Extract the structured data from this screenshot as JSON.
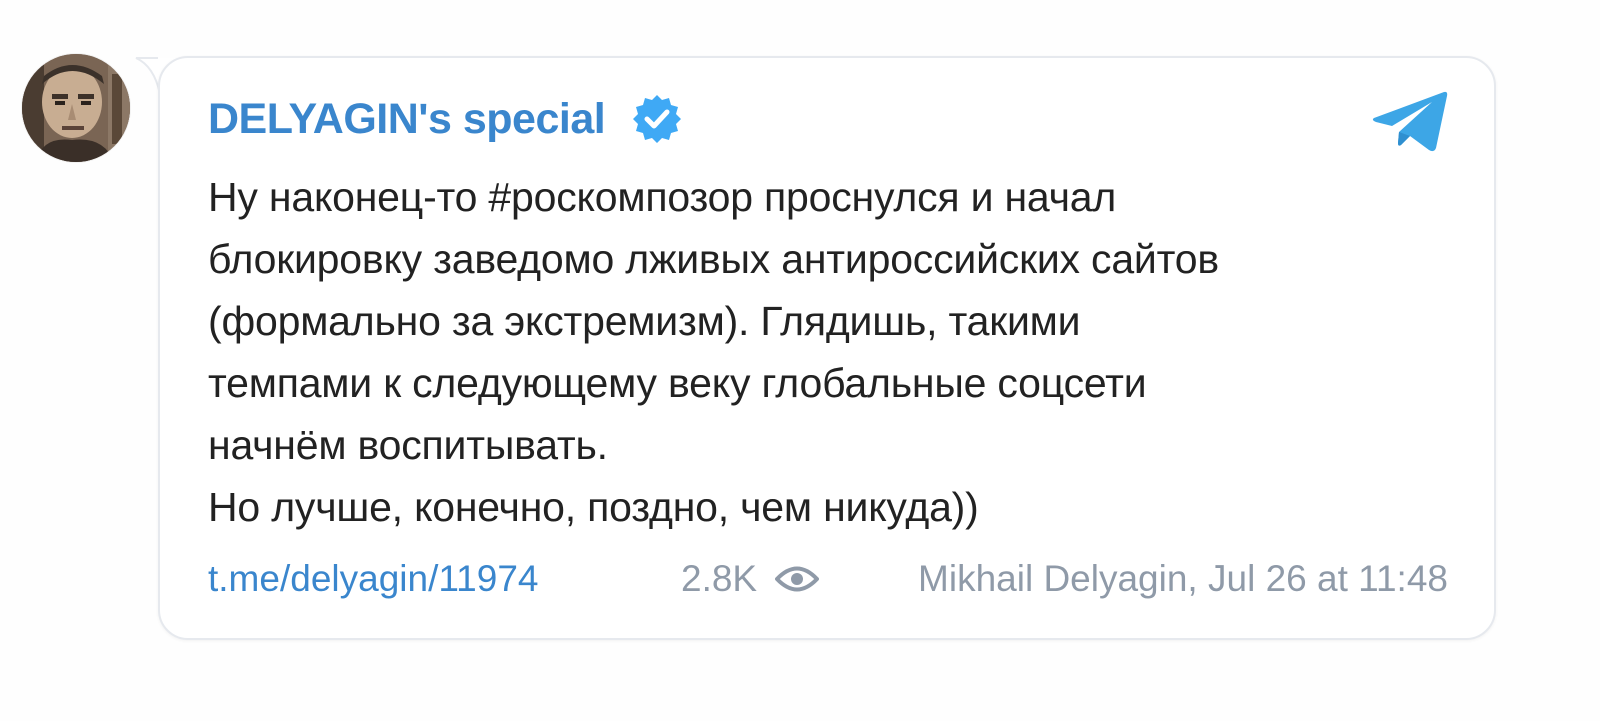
{
  "channel": {
    "name": "DELYAGIN's special",
    "verified_icon": "verified-badge-icon",
    "app_icon": "telegram-plane-icon"
  },
  "message": {
    "lines": [
      "Ну наконец-то #роскомпозор проснулся и начал",
      "блокировку заведомо лживых антироссийских сайтов",
      "(формально за экстремизм). Глядишь, такими",
      "темпами к следующему веку глобальные соцсети",
      "начнём воспитывать.",
      "Но лучше, конечно, поздно, чем никуда))"
    ]
  },
  "footer": {
    "link": "t.me/delyagin/11974",
    "views": "2.8K",
    "views_icon": "eye-icon",
    "author_date": "Mikhail Delyagin, Jul 26 at 11:48"
  },
  "colors": {
    "accent": "#3a86cd",
    "text": "#222222",
    "muted": "#8f9aa8",
    "verified": "#3fa9f5",
    "telegram": "#3da6e6",
    "card_border": "#e6e9ee"
  }
}
